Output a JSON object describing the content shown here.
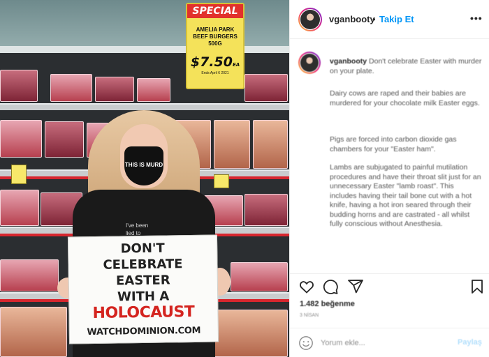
{
  "photo": {
    "special_sign": {
      "header": "SPECIAL",
      "product_line1": "AMELIA PARK",
      "product_line2": "BEEF BURGERS",
      "product_line3": "500G",
      "price": "$7.50",
      "price_suffix": "EA",
      "small_print": "Ends April 6 2021"
    },
    "mask_text": "THIS IS MURD",
    "shirt_text_line1": "I've been",
    "shirt_text_line2": "lied to",
    "protest_sign": {
      "line1": "DON'T",
      "line2": "CELEBRATE",
      "line3": "EASTER",
      "line4": "WITH A",
      "line5": "HOLOCAUST",
      "url": "WATCHDOMINION.COM"
    }
  },
  "post": {
    "username": "vganbooty",
    "separator": "•",
    "follow_label": "Takip Et",
    "more_label": "•••",
    "caption_paragraphs": [
      "Don't celebrate Easter with murder on your plate.",
      "Dairy cows are raped and their babies are murdered for your chocolate milk Easter eggs.",
      "Pigs are forced into carbon dioxide gas chambers for your \"Easter ham\".",
      "Lambs are subjugated to painful mutilation procedures and have their throat slit just for an unnecessary Easter \"lamb roast\". This includes having their tail bone cut with a hot knife, having a hot iron seared through their budding horns and are castrated - all whilst fully conscious without Anesthesia."
    ],
    "likes": "1.482 beğenme",
    "date": "3 NİSAN",
    "comment_placeholder": "Yorum ekle...",
    "post_label": "Paylaş",
    "icons": {
      "like": "heart-icon",
      "comment": "comment-icon",
      "share": "share-icon",
      "save": "bookmark-icon",
      "emoji": "emoji-icon"
    },
    "colors": {
      "link_blue": "#0095f6",
      "text": "#262626",
      "muted": "#8e8e8e",
      "border": "#efefef"
    }
  }
}
